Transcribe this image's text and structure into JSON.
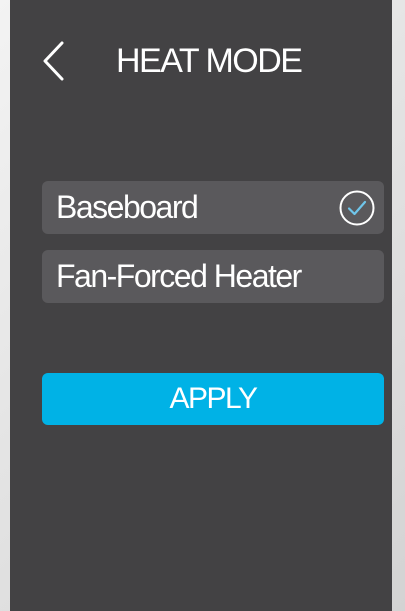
{
  "header": {
    "title": "HEAT MODE",
    "back_icon": "chevron-left-icon"
  },
  "options": [
    {
      "label": "Baseboard",
      "selected": true,
      "icon": "check-circle-icon"
    },
    {
      "label": "Fan-Forced Heater",
      "selected": false
    }
  ],
  "actions": {
    "apply_label": "APPLY"
  },
  "colors": {
    "screen_background": "#434244",
    "option_background": "#5a595c",
    "accent": "#00b2e6",
    "check_stroke": "#6fc5ea",
    "text": "#ffffff"
  }
}
